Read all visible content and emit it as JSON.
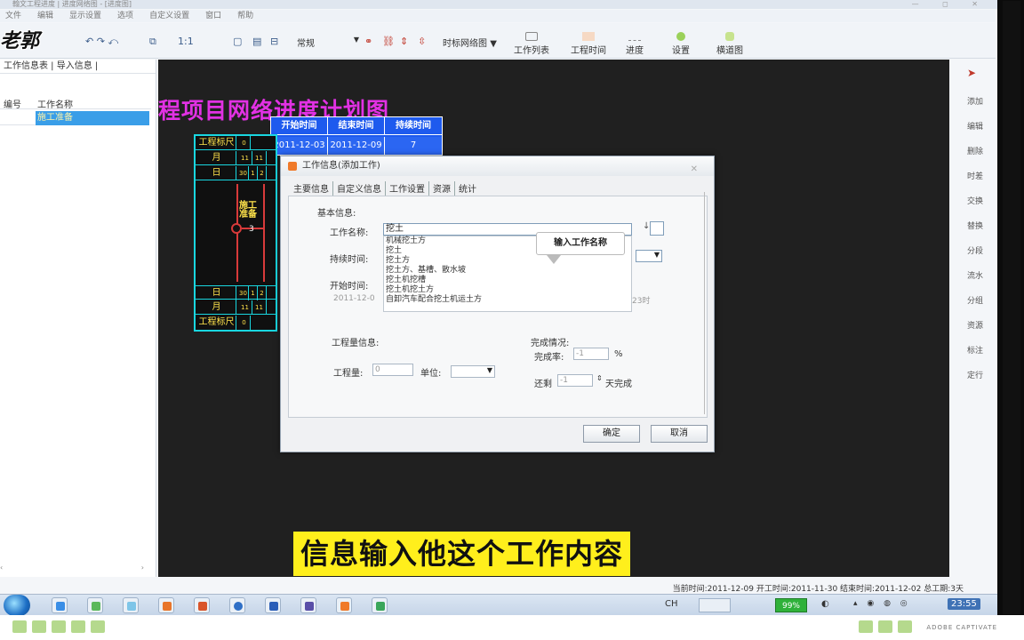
{
  "titlebar": {
    "text": "翰文工程进度 | 进度网络图 - [进度图]",
    "controls": "— ◻ ✕"
  },
  "menu": [
    "文件",
    "编辑",
    "显示设置",
    "选项",
    "自定义设置",
    "窗口",
    "帮助"
  ],
  "watermark": "老郭",
  "toolbar": {
    "style_combo": "常规",
    "net_combo": "时标网络图",
    "buttons": [
      "工作列表",
      "工程时间",
      "进度",
      "设置",
      "横道图"
    ]
  },
  "left_panel": {
    "tabs": "工作信息表 | 导入信息 |",
    "col_index": "编号",
    "col_name": "工作名称",
    "row_name": "施工准备"
  },
  "canvas": {
    "plan_title": "程项目网络进度计划图",
    "date_table": {
      "headers": [
        "开始时间",
        "结束时间",
        "持续时间"
      ],
      "values": [
        "2011-12-03",
        "2011-12-09",
        "7"
      ]
    },
    "scale_labels": [
      "工程标尺",
      "月",
      "日",
      "日",
      "月",
      "工程标尺"
    ],
    "task_label": "施工准备",
    "task_duration": "3"
  },
  "dialog": {
    "title": "工作信息(添加工作)",
    "close": "✕",
    "tabs": [
      "主要信息",
      "自定义信息",
      "工作设置",
      "资源",
      "统计"
    ],
    "section_basic": "基本信息:",
    "label_name": "工作名称:",
    "name_value": "挖土",
    "suggestions": [
      "机械挖土方",
      "挖土",
      "挖土方",
      "挖土方、基槽、散水坡",
      "挖土机挖槽",
      "挖土机挖土方",
      "自卸汽车配合挖土机运土方"
    ],
    "label_duration": "持续时间:",
    "label_start": "开始时间:",
    "start_value": "2011-12-0",
    "start_time_value": "23时",
    "section_quantity": "工程量信息:",
    "label_quantity": "工程量:",
    "quantity_value": "0",
    "label_unit": "单位:",
    "section_progress": "完成情况:",
    "label_rate": "完成率:",
    "rate_value": "-1",
    "rate_unit": "%",
    "label_delay": "还剩",
    "delay_value": "-1",
    "delay_unit": "天完成",
    "ok": "确定",
    "cancel": "取消",
    "tooltip": "输入工作名称"
  },
  "right_panel": [
    "添加",
    "编辑",
    "删除",
    "时差",
    "交换",
    "替换",
    "分段",
    "流水",
    "分组",
    "资源",
    "标注",
    "定行"
  ],
  "status": "当前时间:2011-12-09  开工时间:2011-11-30  结束时间:2011-12-02  总工期:3天",
  "subtitle": "信息输入他这个工作内容",
  "taskbar": {
    "ime": "CH",
    "battery": "99%",
    "clock": "23:55"
  },
  "player": {
    "brand": "ADOBE CAPTIVATE"
  }
}
